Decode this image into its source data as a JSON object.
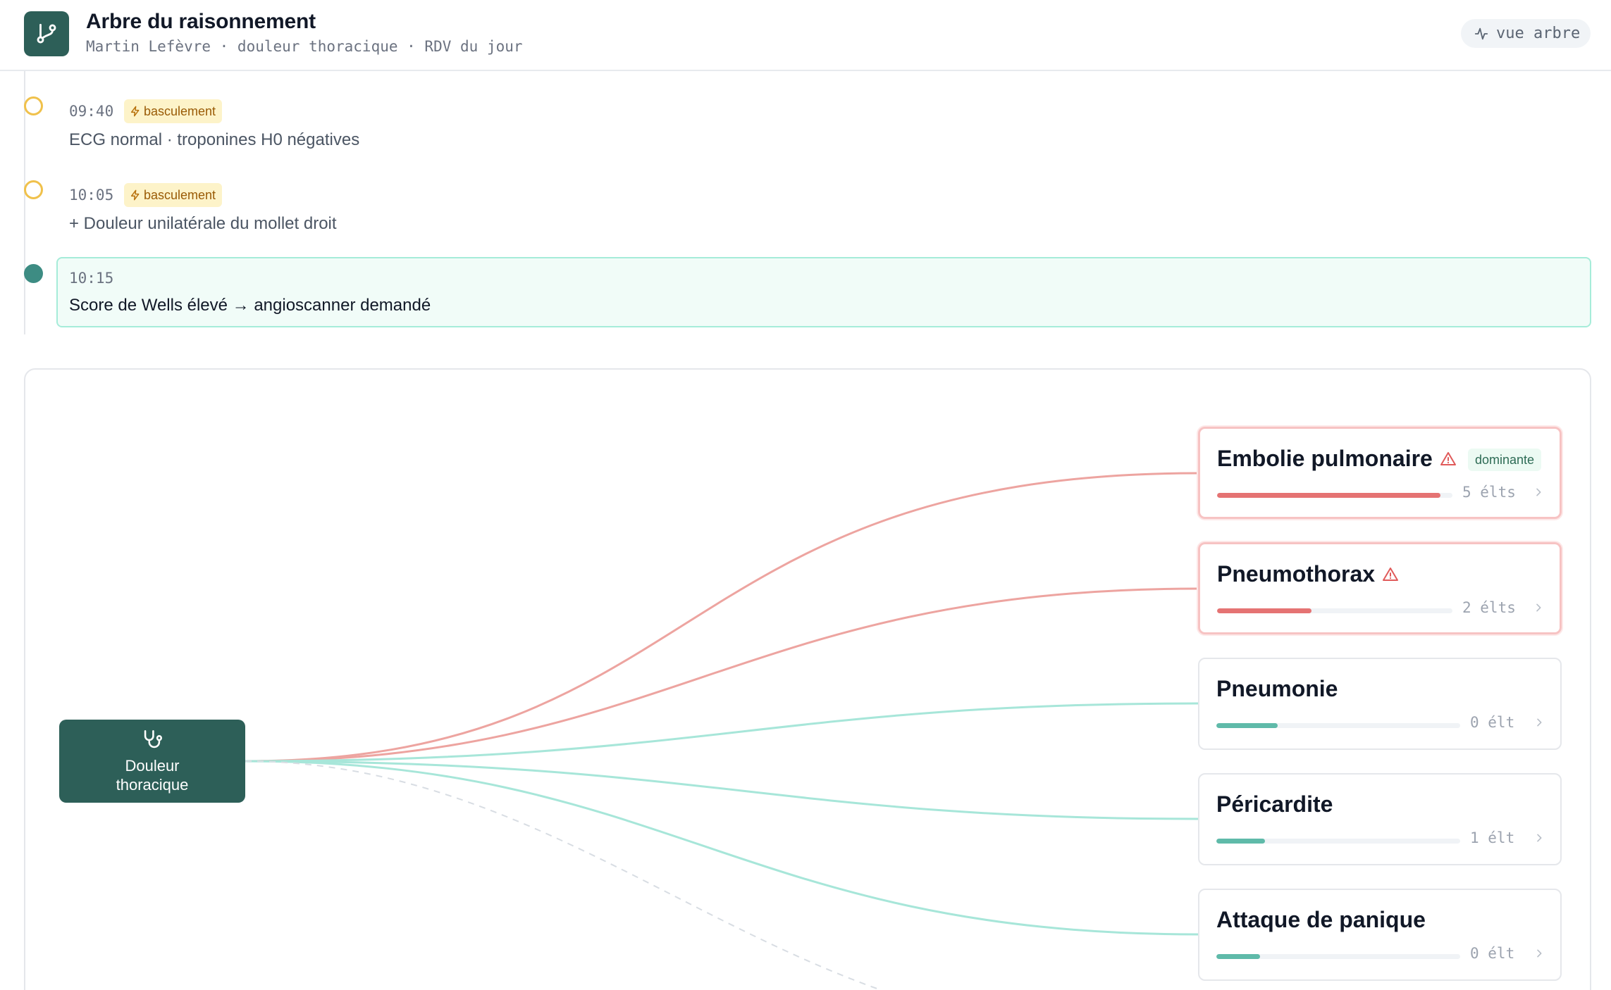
{
  "header": {
    "title": "Arbre du raisonnement",
    "subtitle": "Martin Lefèvre · douleur thoracique · RDV du jour",
    "view_button": "vue arbre",
    "logo_icon": "git-branch-icon",
    "view_icon": "activity-icon"
  },
  "timeline": [
    {
      "time": "09:40",
      "badge": "basculement",
      "text": "ECG normal · troponines H0 négatives",
      "state": "pivot"
    },
    {
      "time": "10:05",
      "badge": "basculement",
      "text": "+ Douleur unilatérale du mollet droit",
      "state": "pivot"
    },
    {
      "time": "10:15",
      "badge": "",
      "text": "Score de Wells élevé → angioscanner demandé",
      "state": "current"
    }
  ],
  "tree": {
    "root": {
      "label": "Douleur thoracique",
      "icon": "stethoscope-icon"
    },
    "diagnoses": [
      {
        "name": "Embolie pulmonaire",
        "alert": true,
        "badge": "dominante",
        "count": "5 élts",
        "level": 0.95
      },
      {
        "name": "Pneumothorax",
        "alert": true,
        "badge": "",
        "count": "2 élts",
        "level": 0.4
      },
      {
        "name": "Pneumonie",
        "alert": false,
        "badge": "",
        "count": "0 élt",
        "level": 0.25
      },
      {
        "name": "Péricardite",
        "alert": false,
        "badge": "",
        "count": "1 élt",
        "level": 0.2
      },
      {
        "name": "Attaque de panique",
        "alert": false,
        "badge": "",
        "count": "0 élt",
        "level": 0.18
      }
    ]
  },
  "colors": {
    "brand": "#2d5f58",
    "alert": "#e57373",
    "alert_link": "#eda4a0",
    "normal": "#5fbaa9",
    "normal_link": "#a7e6d9",
    "pivot": "#f0c14b"
  }
}
